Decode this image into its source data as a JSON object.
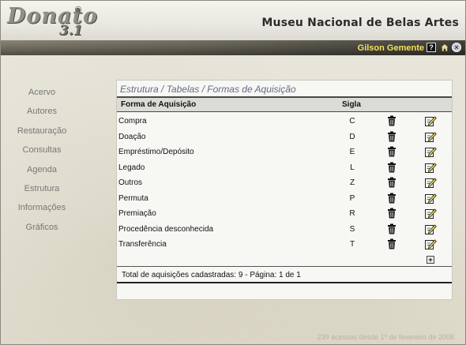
{
  "header": {
    "logo_text": "Donato",
    "logo_version": "3.1",
    "logo_reg": "®",
    "museum_name": "Museu Nacional de Belas Artes"
  },
  "userbar": {
    "user_name": "Gilson Gemente",
    "icons": [
      "help-icon",
      "home-icon",
      "close-icon"
    ]
  },
  "sidebar": {
    "items": [
      {
        "label": "Acervo"
      },
      {
        "label": "Autores"
      },
      {
        "label": "Restauração"
      },
      {
        "label": "Consultas"
      },
      {
        "label": "Agenda"
      },
      {
        "label": "Estrutura"
      },
      {
        "label": "Informações"
      },
      {
        "label": "Gráficos"
      }
    ]
  },
  "panel": {
    "breadcrumb": "Estrutura / Tabelas / Formas de Aquisição",
    "columns": {
      "forma": "Forma de Aquisição",
      "sigla": "Sigla"
    },
    "rows": [
      {
        "nome": "Compra",
        "sigla": "C"
      },
      {
        "nome": "Doação",
        "sigla": "D"
      },
      {
        "nome": "Empréstimo/Depósito",
        "sigla": "E"
      },
      {
        "nome": "Legado",
        "sigla": "L"
      },
      {
        "nome": "Outros",
        "sigla": "Z"
      },
      {
        "nome": "Permuta",
        "sigla": "P"
      },
      {
        "nome": "Premiação",
        "sigla": "R"
      },
      {
        "nome": "Procedência desconhecida",
        "sigla": "S"
      },
      {
        "nome": "Transferência",
        "sigla": "T"
      }
    ],
    "row_icons": [
      "trash-icon",
      "edit-icon"
    ],
    "add_label": "+",
    "footer": "Total de aquisições cadastradas: 9 - Página: 1 de 1"
  },
  "access_counter": "239 acessos desde 1º de fevereiro de 2008",
  "colors": {
    "breadcrumb": "#646c86",
    "user_name": "#f3e35a",
    "nav_text": "#777777"
  }
}
